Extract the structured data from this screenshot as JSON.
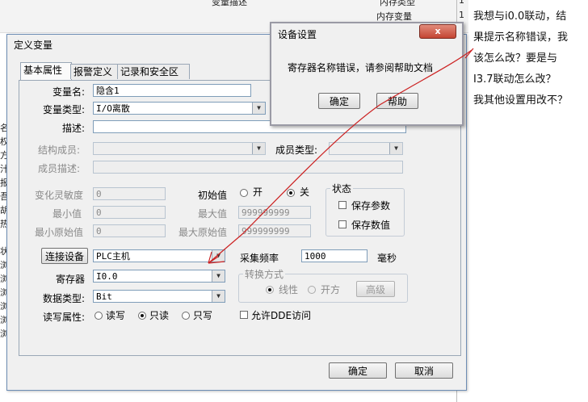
{
  "background": {
    "column_header": "变量描述",
    "column_header_right": "内存类型",
    "row_value": "内存变量",
    "row_num": "1",
    "row_num_2": "1",
    "left_chars": [
      "名",
      "权",
      "方",
      "汁",
      "报",
      "吾",
      "胡",
      "热",
      "",
      "状",
      "浏",
      "浏",
      "浏",
      "浏",
      "浏",
      "浏"
    ]
  },
  "dialog": {
    "title": "定义变量",
    "tabs": [
      "基本属性",
      "报警定义",
      "记录和安全区"
    ],
    "var_name_label": "变量名:",
    "var_name": "隐含1",
    "var_type_label": "变量类型:",
    "var_type": "I/O离散",
    "desc_label": "描述:",
    "desc": "",
    "struct_member_label": "结构成员:",
    "member_type_label": "成员类型:",
    "member_desc_label": "成员描述:",
    "sensitivity_label": "变化灵敏度",
    "sensitivity": "0",
    "initial_label": "初始值",
    "initial_on": "开",
    "initial_off": "关",
    "min_label": "最小值",
    "min": "0",
    "max_label": "最大值",
    "max": "999999999",
    "min_raw_label": "最小原始值",
    "min_raw": "0",
    "max_raw_label": "最大原始值",
    "max_raw": "999999999",
    "status_title": "状态",
    "save_params": "保存参数",
    "save_values": "保存数值",
    "connect_button": "连接设备",
    "device": "PLC主机",
    "freq_label": "采集频率",
    "freq": "1000",
    "freq_unit": "毫秒",
    "register_label": "寄存器",
    "register": "I0.0",
    "convert_title": "转换方式",
    "linear": "线性",
    "sqrt": "开方",
    "advanced": "高级",
    "datatype_label": "数据类型:",
    "datatype": "Bit",
    "rw_label": "读写属性:",
    "rw_readwrite": "读写",
    "rw_readonly": "只读",
    "rw_writeonly": "只写",
    "dde_label": "允许DDE访问",
    "ok": "确定",
    "cancel": "取消"
  },
  "popup": {
    "title": "设备设置",
    "close": "x",
    "message": "寄存器名称错误，请参阅帮助文档",
    "ok": "确定",
    "help": "帮助"
  },
  "question_lines": [
    "我想与i0.0联动，结",
    "果提示名称错误，我",
    "该怎么改？要是与",
    "I3.7联动怎么改？",
    "我其他设置用改不？"
  ],
  "colors": {
    "annotation": "#cc2222",
    "close_button": "#c44533"
  }
}
